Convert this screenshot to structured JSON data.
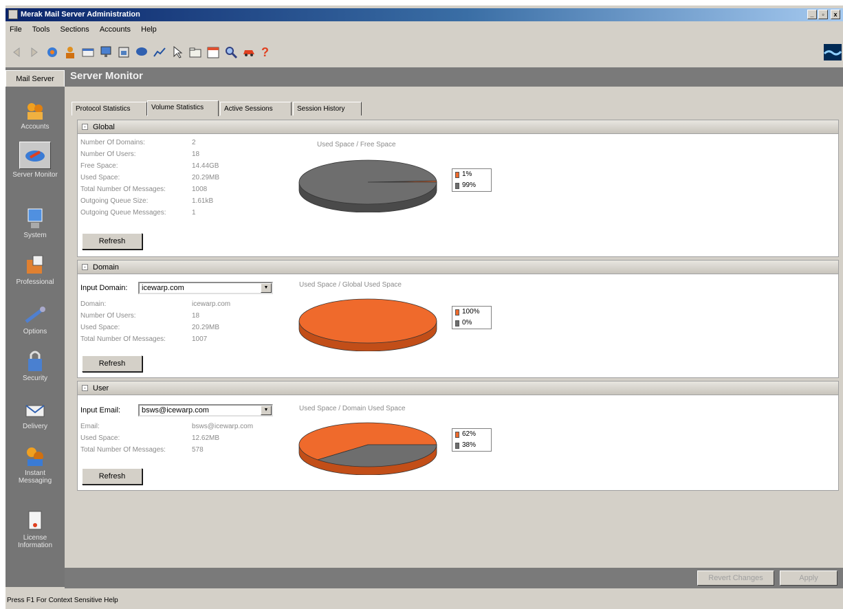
{
  "window": {
    "title": "Merak Mail Server Administration"
  },
  "menu": [
    "File",
    "Tools",
    "Sections",
    "Accounts",
    "Help"
  ],
  "nav": {
    "tab_label": "Mail Server",
    "header_title": "Server Monitor"
  },
  "sidebar": [
    {
      "label": "Accounts",
      "icon": "accounts-icon"
    },
    {
      "label": "Server Monitor",
      "icon": "server-monitor-icon",
      "selected": true
    },
    {
      "label": "System",
      "icon": "system-icon"
    },
    {
      "label": "Professional",
      "icon": "professional-icon"
    },
    {
      "label": "Options",
      "icon": "options-icon"
    },
    {
      "label": "Security",
      "icon": "security-icon"
    },
    {
      "label": "Delivery",
      "icon": "delivery-icon"
    },
    {
      "label": "Instant Messaging",
      "icon": "instant-messaging-icon"
    },
    {
      "label": "License Information",
      "icon": "license-icon"
    }
  ],
  "tabs": [
    "Protocol Statistics",
    "Volume Statistics",
    "Active Sessions",
    "Session History"
  ],
  "active_tab": "Volume Statistics",
  "global": {
    "title": "Global",
    "fields": [
      {
        "label": "Number Of Domains:",
        "value": "2"
      },
      {
        "label": "Number Of Users:",
        "value": "18"
      },
      {
        "label": "Free Space:",
        "value": "14.44GB"
      },
      {
        "label": "Used Space:",
        "value": "20.29MB"
      },
      {
        "label": "Total Number Of Messages:",
        "value": "1008"
      },
      {
        "label": "Outgoing Queue Size:",
        "value": "1.61kB"
      },
      {
        "label": "Outgoing Queue Messages:",
        "value": "1"
      }
    ],
    "refresh": "Refresh",
    "chart_title": "Used Space / Free Space",
    "legend": [
      "1%",
      "99%"
    ]
  },
  "domain": {
    "title": "Domain",
    "input_label": "Input Domain:",
    "input_value": "icewarp.com",
    "fields": [
      {
        "label": "Domain:",
        "value": "icewarp.com"
      },
      {
        "label": "Number Of Users:",
        "value": "18"
      },
      {
        "label": "Used Space:",
        "value": "20.29MB"
      },
      {
        "label": "Total Number Of Messages:",
        "value": "1007"
      }
    ],
    "refresh": "Refresh",
    "chart_title": "Used Space / Global Used Space",
    "legend": [
      "100%",
      "0%"
    ]
  },
  "user": {
    "title": "User",
    "input_label": "Input Email:",
    "input_value": "bsws@icewarp.com",
    "fields": [
      {
        "label": "Email:",
        "value": "bsws@icewarp.com"
      },
      {
        "label": "Used Space:",
        "value": "12.62MB"
      },
      {
        "label": "Total Number Of Messages:",
        "value": "578"
      }
    ],
    "refresh": "Refresh",
    "chart_title": "Used Space / Domain Used Space",
    "legend": [
      "62%",
      "38%"
    ]
  },
  "bottom": {
    "revert": "Revert Changes",
    "apply": "Apply"
  },
  "status": "Press F1 For Context Sensitive Help",
  "colors": {
    "used": "#ef6a2c",
    "free": "#6e6e6e",
    "accent": "#0a246a"
  },
  "chart_data": [
    {
      "type": "pie",
      "title": "Used Space / Free Space",
      "labels": [
        "1%",
        "99%"
      ],
      "values": [
        1,
        99
      ]
    },
    {
      "type": "pie",
      "title": "Used Space / Global Used Space",
      "labels": [
        "100%",
        "0%"
      ],
      "values": [
        100,
        0
      ]
    },
    {
      "type": "pie",
      "title": "Used Space / Domain Used Space",
      "labels": [
        "62%",
        "38%"
      ],
      "values": [
        62,
        38
      ]
    }
  ]
}
